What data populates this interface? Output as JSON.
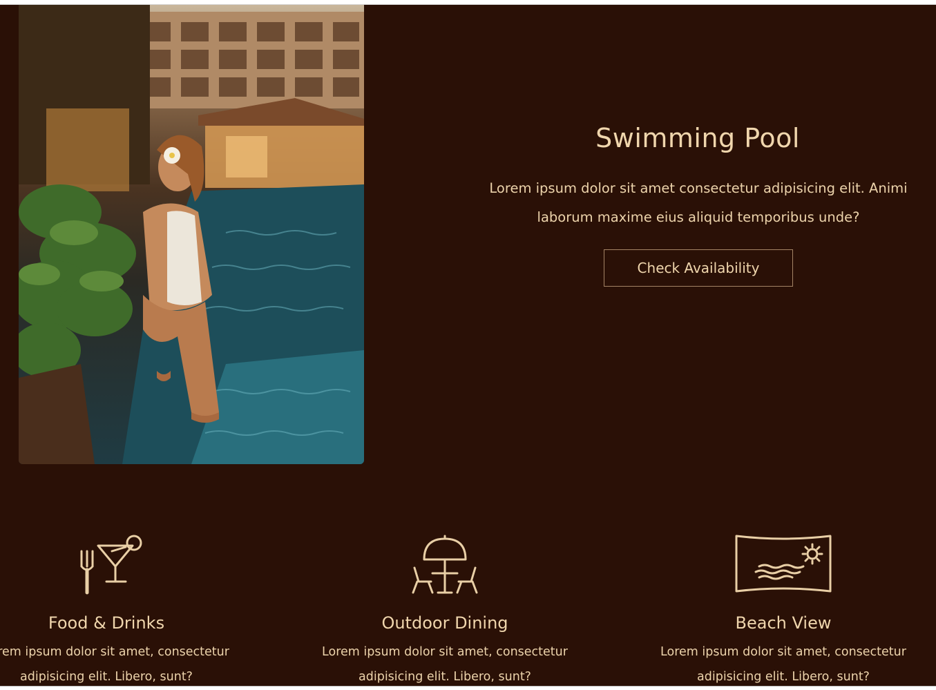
{
  "feature": {
    "title": "Swimming Pool",
    "description": "Lorem ipsum dolor sit amet consectetur adipisicing elit. Animi laborum maxime eius aliquid temporibus unde?",
    "button_label": "Check Availability"
  },
  "amenities": [
    {
      "title": "Food & Drinks",
      "line1": "Lorem ipsum dolor sit amet, consectetur",
      "line2": "adipisicing elit. Libero, sunt?",
      "icon": "cocktail-fork-icon"
    },
    {
      "title": "Outdoor Dining",
      "line1": "Lorem ipsum dolor sit amet, consectetur",
      "line2": "adipisicing elit. Libero, sunt?",
      "icon": "umbrella-table-icon"
    },
    {
      "title": "Beach View",
      "line1": "Lorem ipsum dolor sit amet, consectetur",
      "line2": "adipisicing elit. Libero, sunt?",
      "icon": "beach-view-icon"
    }
  ],
  "colors": {
    "background": "#2a1006",
    "accent_text": "#f0d6ad",
    "icon_stroke": "#e9cfa6"
  }
}
